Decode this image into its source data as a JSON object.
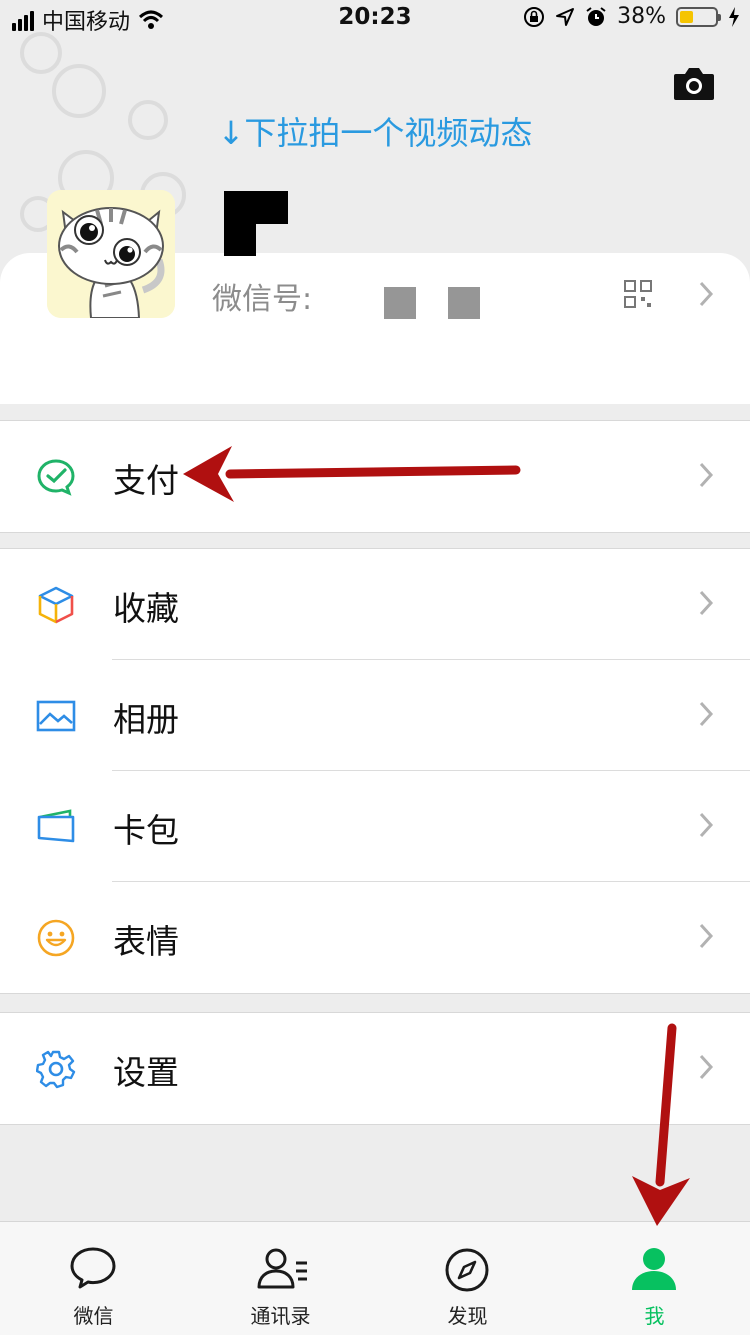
{
  "status_bar": {
    "carrier": "中国移动",
    "time": "20:23",
    "battery": "38%",
    "battery_level": 0.38
  },
  "header": {
    "pull_hint": "↓下拉拍一个视频动态"
  },
  "profile": {
    "wechat_id_label": "微信号:"
  },
  "menu": {
    "pay": "支付",
    "favorites": "收藏",
    "album": "相册",
    "cards": "卡包",
    "stickers": "表情",
    "settings": "设置"
  },
  "tabs": [
    {
      "label": "微信",
      "icon": "chat-bubble-icon"
    },
    {
      "label": "通讯录",
      "icon": "contacts-icon"
    },
    {
      "label": "发现",
      "icon": "compass-icon"
    },
    {
      "label": "我",
      "icon": "person-icon"
    }
  ],
  "colors": {
    "accent": "#07c160",
    "hint": "#2a9ae0",
    "annotation": "#b01010"
  }
}
